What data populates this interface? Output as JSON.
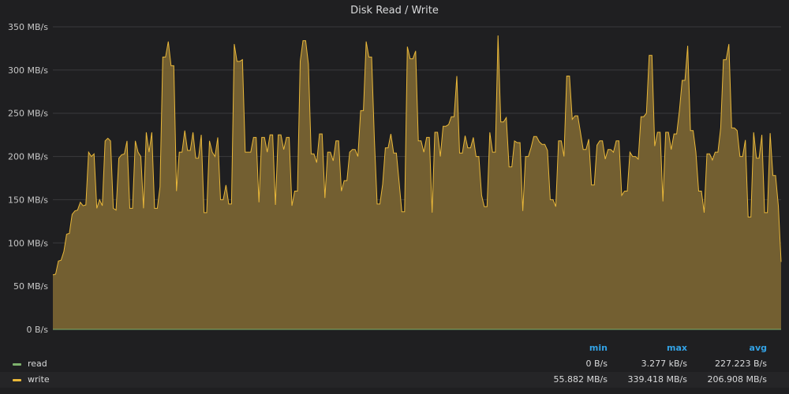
{
  "panel": {
    "title": "Disk Read / Write"
  },
  "colors": {
    "read": "#7eb26d",
    "write": "#eab839",
    "write_fill": "#735f31",
    "grid": "#3a3a3d"
  },
  "legend": {
    "headers": {
      "min": "min",
      "max": "max",
      "avg": "avg"
    },
    "rows": [
      {
        "name": "read",
        "min": "0 B/s",
        "max": "3.277 kB/s",
        "avg": "227.223 B/s"
      },
      {
        "name": "write",
        "min": "55.882 MB/s",
        "max": "339.418 MB/s",
        "avg": "206.908 MB/s"
      }
    ]
  },
  "chart_data": {
    "type": "area",
    "title": "Disk Read / Write",
    "ylim": [
      0,
      350
    ],
    "y_ticks": [
      0,
      50,
      100,
      150,
      200,
      250,
      300,
      350
    ],
    "y_tick_labels": [
      "0 B/s",
      "50 MB/s",
      "100 MB/s",
      "150 MB/s",
      "200 MB/s",
      "250 MB/s",
      "300 MB/s",
      "350 MB/s"
    ],
    "grid": true,
    "legend_placement": "bottom",
    "series": [
      {
        "name": "read",
        "values": [
          0,
          0,
          0,
          0,
          0,
          0,
          0,
          0,
          0,
          0,
          0,
          0,
          0,
          0,
          0,
          0,
          0,
          0,
          0,
          0,
          0,
          0,
          0,
          0,
          0,
          0,
          0,
          0,
          0,
          0,
          0,
          0,
          0,
          0,
          0,
          0,
          0,
          0,
          0,
          0,
          0,
          0,
          0,
          0,
          0,
          0,
          0,
          0,
          0,
          0
        ]
      },
      {
        "name": "write",
        "values": [
          63,
          64,
          79,
          80,
          90,
          110,
          111,
          133,
          137,
          138,
          147,
          143,
          144,
          205,
          200,
          203,
          140,
          150,
          143,
          218,
          221,
          218,
          140,
          138,
          198,
          202,
          203,
          218,
          140,
          140,
          218,
          205,
          200,
          140,
          228,
          205,
          228,
          140,
          140,
          165,
          315,
          315,
          333,
          305,
          305,
          160,
          205,
          205,
          230,
          207,
          207,
          228,
          198,
          198,
          225,
          135,
          135,
          218,
          205,
          200,
          222,
          150,
          150,
          167,
          145,
          145,
          330,
          310,
          310,
          312,
          205,
          205,
          205,
          222,
          222,
          147,
          222,
          222,
          205,
          225,
          225,
          144,
          225,
          225,
          208,
          222,
          222,
          143,
          160,
          160,
          310,
          334,
          334,
          307,
          203,
          203,
          193,
          226,
          226,
          152,
          205,
          205,
          195,
          218,
          218,
          160,
          172,
          172,
          205,
          208,
          208,
          200,
          253,
          253,
          333,
          315,
          315,
          220,
          145,
          145,
          168,
          210,
          210,
          226,
          204,
          204,
          170,
          136,
          136,
          327,
          313,
          313,
          322,
          218,
          218,
          205,
          222,
          222,
          135,
          228,
          228,
          200,
          235,
          235,
          237,
          246,
          246,
          293,
          204,
          204,
          224,
          210,
          210,
          222,
          200,
          200,
          155,
          142,
          142,
          228,
          205,
          205,
          340,
          240,
          240,
          245,
          188,
          188,
          218,
          216,
          216,
          137,
          200,
          200,
          210,
          223,
          223,
          217,
          214,
          214,
          207,
          150,
          150,
          142,
          218,
          218,
          200,
          293,
          293,
          243,
          247,
          247,
          228,
          208,
          208,
          220,
          167,
          167,
          213,
          218,
          218,
          197,
          208,
          208,
          205,
          218,
          218,
          155,
          160,
          160,
          205,
          200,
          200,
          197,
          246,
          246,
          250,
          317,
          317,
          212,
          228,
          228,
          148,
          228,
          228,
          208,
          226,
          226,
          253,
          288,
          288,
          328,
          230,
          230,
          205,
          160,
          160,
          135,
          203,
          203,
          196,
          205,
          205,
          233,
          312,
          312,
          330,
          233,
          233,
          230,
          200,
          200,
          219,
          130,
          130,
          228,
          198,
          198,
          225,
          135,
          135,
          227,
          178,
          178,
          143,
          78
        ]
      }
    ]
  }
}
